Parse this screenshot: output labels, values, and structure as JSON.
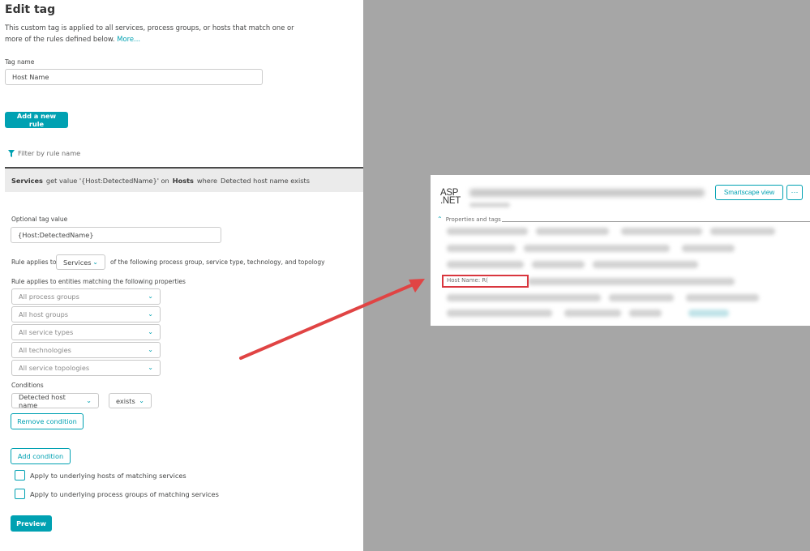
{
  "edit_tag": {
    "title": "Edit tag",
    "description": "This custom tag is applied to all services, process groups, or hosts that match one or more of the rules defined below.",
    "more_link": "More...",
    "tag_name_label": "Tag name",
    "tag_name_value": "Host Name",
    "add_rule_button": "Add a new rule",
    "filter_placeholder": "Filter by rule name"
  },
  "rule_summary": {
    "entity": "Services",
    "get_value_text": "get value '{Host:DetectedName}' on",
    "target": "Hosts",
    "where_text": "where",
    "condition_text": "Detected host name exists"
  },
  "rule_form": {
    "optional_tag_value_label": "Optional tag value",
    "optional_tag_value": "{Host:DetectedName}",
    "applies_to_label": "Rule applies to",
    "applies_to_value": "Services",
    "applies_to_suffix": "of the following process group, service type, technology, and topology",
    "matching_label": "Rule applies to entities matching the following properties",
    "filters": {
      "process_groups": "All process groups",
      "host_groups": "All host groups",
      "service_types": "All service types",
      "technologies": "All technologies",
      "service_topologies": "All service topologies"
    },
    "conditions_label": "Conditions",
    "condition_property": "Detected host name",
    "condition_operator": "exists",
    "remove_condition_button": "Remove condition",
    "add_condition_button": "Add condition",
    "checkbox_hosts_label": "Apply to underlying hosts of matching services",
    "checkbox_process_groups_label": "Apply to underlying process groups of matching services",
    "preview_button": "Preview"
  },
  "service_card": {
    "logo_line1": "ASP",
    "logo_line2": ".NET",
    "smartscape_button": "Smartscape view",
    "more_button": "···",
    "section_label": "Properties and tags",
    "host_name_tag": "Host Name: R("
  },
  "colors": {
    "accent": "#00a1b2",
    "highlight": "#d9363e",
    "arrow": "#e04444",
    "backdrop": "#a6a6a6"
  }
}
